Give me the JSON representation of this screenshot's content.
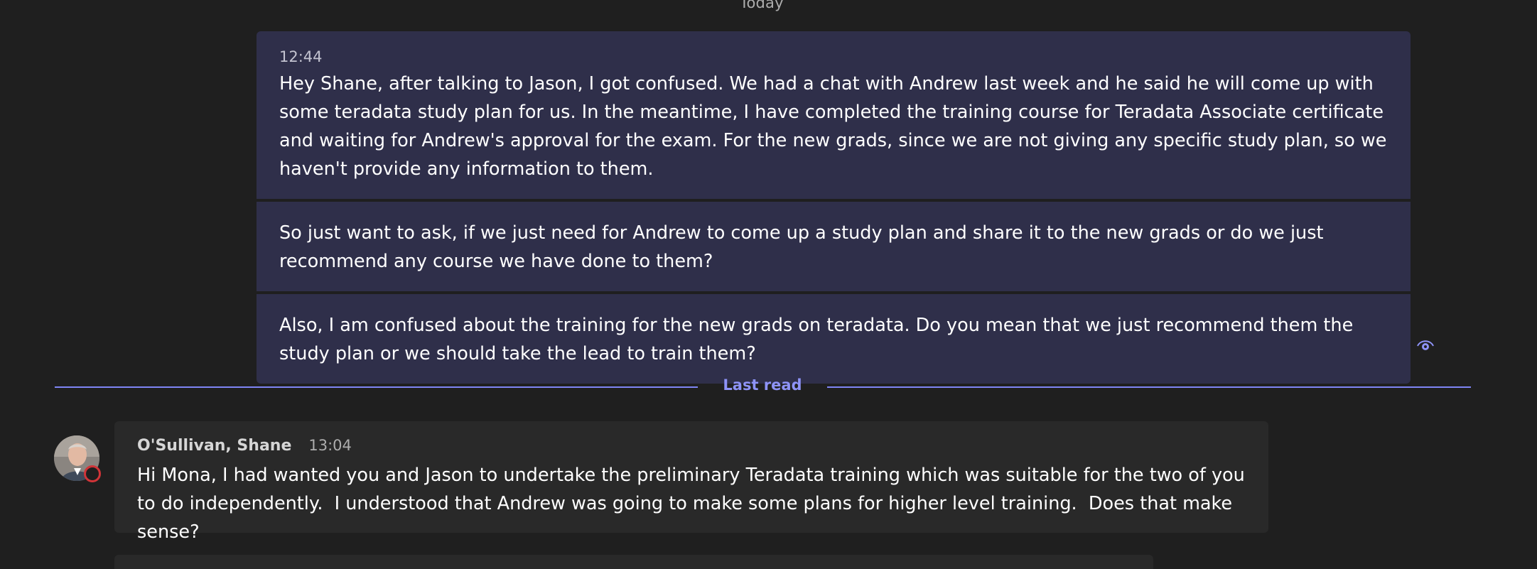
{
  "chat": {
    "day_label": "Today",
    "sent_messages": [
      {
        "time": "12:44",
        "text": "Hey Shane, after talking to Jason, I got confused. We had a chat with Andrew last week and he said he will come up with some teradata study plan for us. In the meantime, I have completed the training course for Teradata Associate certificate and waiting for Andrew's approval for the exam. For the new grads, since we are not giving any specific study plan, so we haven't provide any information to them."
      },
      {
        "text": "So just want to ask, if we just need for Andrew to come up a study plan and share it to the new grads or do we just recommend any course we have done to them?"
      },
      {
        "text": "Also, I am confused about the training for the new grads on teradata. Do you mean that we just recommend them the study plan or we should take the lead to train them?"
      }
    ],
    "seen_icon": "eye-icon",
    "last_read_label": "Last read",
    "received_message": {
      "sender": "O'Sullivan, Shane",
      "time": "13:04",
      "text": "Hi Mona, I had wanted you and Jason to undertake the preliminary Teradata training which was suitable for the two of you to do independently.  I understood that Andrew was going to make some plans for higher level training.  Does that make sense?",
      "presence": "do-not-disturb"
    }
  },
  "colors": {
    "background": "#1f1f1f",
    "sent_bubble": "#2f2f4a",
    "received_bubble": "#292929",
    "accent": "#7f85f5",
    "presence_dnd": "#d13438"
  }
}
